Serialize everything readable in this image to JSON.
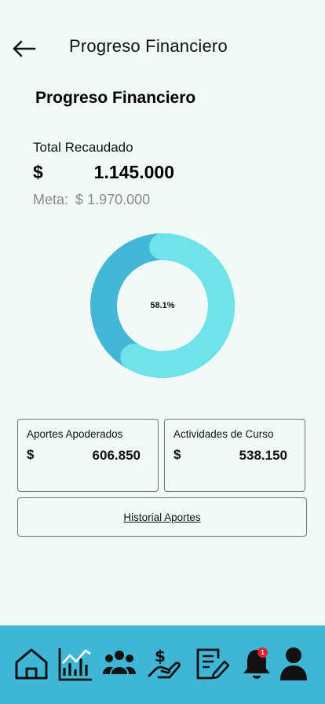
{
  "header": {
    "title": "Progreso Financiero"
  },
  "main": {
    "section_title": "Progreso Financiero",
    "total_label": "Total Recaudado",
    "total_currency": "$",
    "total_amount": "1.145.000",
    "goal_label": "Meta:",
    "goal_currency": "$",
    "goal_amount": "1.970.000",
    "progress_label": "58.1%",
    "progress_fraction": 0.581,
    "progress_color": "#6ee3ea",
    "remaining_color": "#45b7d6"
  },
  "cards": [
    {
      "title": "Aportes Apoderados",
      "currency": "$",
      "amount": "606.850"
    },
    {
      "title": "Actividades de Curso",
      "currency": "$",
      "amount": "538.150"
    }
  ],
  "history_button": {
    "label": "Historial Aportes"
  },
  "bottom_nav": {
    "background": "#3fb6d6",
    "items": [
      {
        "icon": "home-icon"
      },
      {
        "icon": "chart-icon"
      },
      {
        "icon": "users-icon"
      },
      {
        "icon": "payment-hand-icon"
      },
      {
        "icon": "edit-document-icon"
      },
      {
        "icon": "bell-icon",
        "badge": "1"
      },
      {
        "icon": "user-icon"
      }
    ]
  }
}
